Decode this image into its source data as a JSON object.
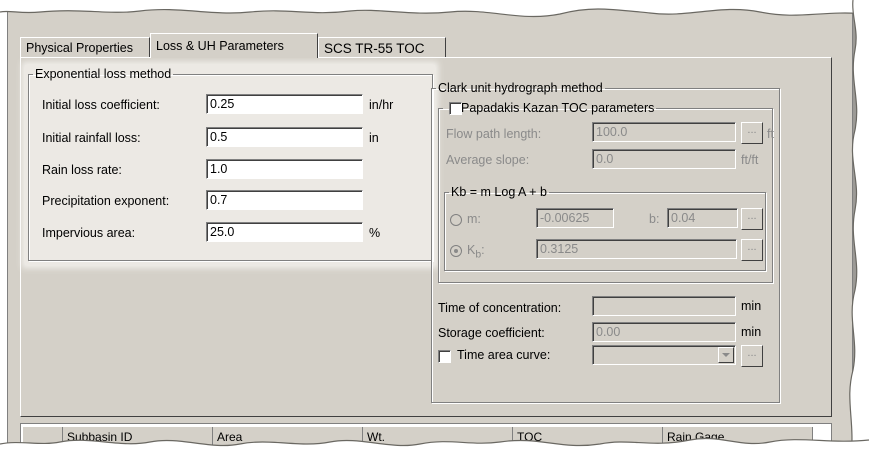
{
  "tabs": [
    {
      "label": "Physical Properties"
    },
    {
      "label": "Loss & UH Parameters"
    },
    {
      "label": "SCS TR-55 TOC"
    }
  ],
  "loss": {
    "legend": "Exponential loss method",
    "rows": [
      {
        "label": "Initial loss coefficient:",
        "value": "0.25",
        "unit": "in/hr"
      },
      {
        "label": "Initial rainfall loss:",
        "value": "0.5",
        "unit": "in"
      },
      {
        "label": "Rain loss rate:",
        "value": "1.0",
        "unit": ""
      },
      {
        "label": "Precipitation exponent:",
        "value": "0.7",
        "unit": ""
      },
      {
        "label": "Impervious area:",
        "value": "25.0",
        "unit": "%"
      }
    ]
  },
  "clark": {
    "legend": "Clark unit hydrograph method",
    "papadakis": {
      "legend": "Papadakis Kazan TOC parameters",
      "flow_label": "Flow path length:",
      "flow_value": "100.0",
      "flow_unit": "ft",
      "slope_label": "Average slope:",
      "slope_value": "0.0",
      "slope_unit": "ft/ft",
      "button": "..."
    },
    "kb": {
      "legend": "Kb = m Log A + b",
      "m_label": "m:",
      "m_value": "-0.00625",
      "b_label": "b:",
      "b_value": "0.04",
      "kb_label": "K",
      "kb_sub": "b",
      "kb_suffix": ":",
      "kb_value": "0.3125",
      "button": "..."
    },
    "toc_label": "Time of concentration:",
    "toc_value": "",
    "toc_unit": "min",
    "storage_label": "Storage coefficient:",
    "storage_value": "0.00",
    "storage_unit": "min",
    "time_area_label": "Time area curve:",
    "button": "..."
  },
  "grid": {
    "headers": [
      "",
      "Subbasin ID",
      "Area",
      "Wt.",
      "TOC",
      "Rain Gage"
    ]
  }
}
